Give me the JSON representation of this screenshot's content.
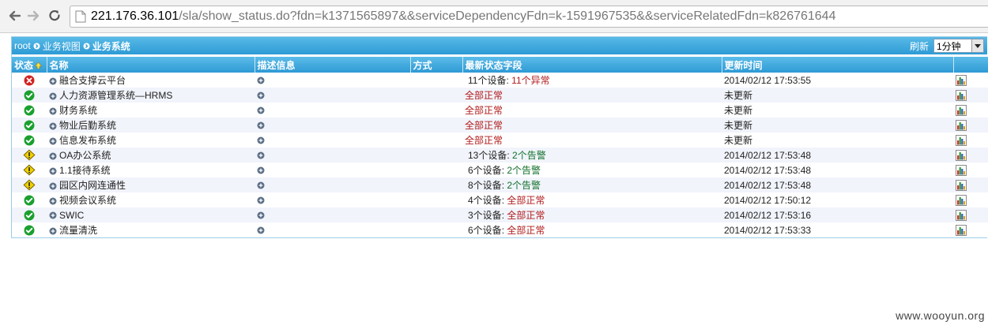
{
  "browser": {
    "url_host": "221.176.36.101",
    "url_path": "/sla/show_status.do?fdn=k1371565897&&serviceDependencyFdn=k-1591967535&&serviceRelatedFdn=k826761644"
  },
  "breadcrumb": [
    "root",
    "业务视图",
    "业务系统"
  ],
  "refresh": {
    "label": "刷新",
    "selected": "1分钟"
  },
  "columns": {
    "status": "状态",
    "name": "名称",
    "desc": "描述信息",
    "method": "方式",
    "latest": "最新状态字段",
    "updated": "更新时间"
  },
  "colors": {
    "header": "#2e9ad5",
    "ok": "#1aa02e",
    "error": "#d22020",
    "warn": "#f0d200",
    "alert_text": "#b21a1a",
    "ok_text": "#12702a"
  },
  "rows": [
    {
      "status": "error",
      "name": "融合支撑云平台",
      "devices": "11个设备",
      "sep": ":",
      "result": "11个异常",
      "result_color": "red",
      "updated": "2014/02/12 17:53:55"
    },
    {
      "status": "ok",
      "name": "人力资源管理系统—HRMS",
      "devices": "",
      "sep": "",
      "result": "全部正常",
      "result_color": "red",
      "updated": "未更新"
    },
    {
      "status": "ok",
      "name": "财务系统",
      "devices": "",
      "sep": "",
      "result": "全部正常",
      "result_color": "red",
      "updated": "未更新"
    },
    {
      "status": "ok",
      "name": "物业后勤系统",
      "devices": "",
      "sep": "",
      "result": "全部正常",
      "result_color": "red",
      "updated": "未更新"
    },
    {
      "status": "ok",
      "name": "信息发布系统",
      "devices": "",
      "sep": "",
      "result": "全部正常",
      "result_color": "red",
      "updated": "未更新"
    },
    {
      "status": "warn",
      "name": "OA办公系统",
      "devices": "13个设备",
      "sep": ":",
      "result": "2个告警",
      "result_color": "green",
      "updated": "2014/02/12 17:53:48"
    },
    {
      "status": "warn",
      "name": "1.1接待系统",
      "devices": "6个设备",
      "sep": ":",
      "result": "2个告警",
      "result_color": "green",
      "updated": "2014/02/12 17:53:48"
    },
    {
      "status": "warn",
      "name": "园区内网连通性",
      "devices": "8个设备",
      "sep": ":",
      "result": "2个告警",
      "result_color": "green",
      "updated": "2014/02/12 17:53:48"
    },
    {
      "status": "ok",
      "name": "视频会议系统",
      "devices": "4个设备",
      "sep": ":",
      "result": "全部正常",
      "result_color": "red",
      "updated": "2014/02/12 17:50:12"
    },
    {
      "status": "ok",
      "name": "SWIC",
      "devices": "3个设备",
      "sep": ":",
      "result": "全部正常",
      "result_color": "red",
      "updated": "2014/02/12 17:53:16"
    },
    {
      "status": "ok",
      "name": "流量清洗",
      "devices": "6个设备",
      "sep": ":",
      "result": "全部正常",
      "result_color": "red",
      "updated": "2014/02/12 17:53:33"
    }
  ],
  "watermark": "www.wooyun.org"
}
